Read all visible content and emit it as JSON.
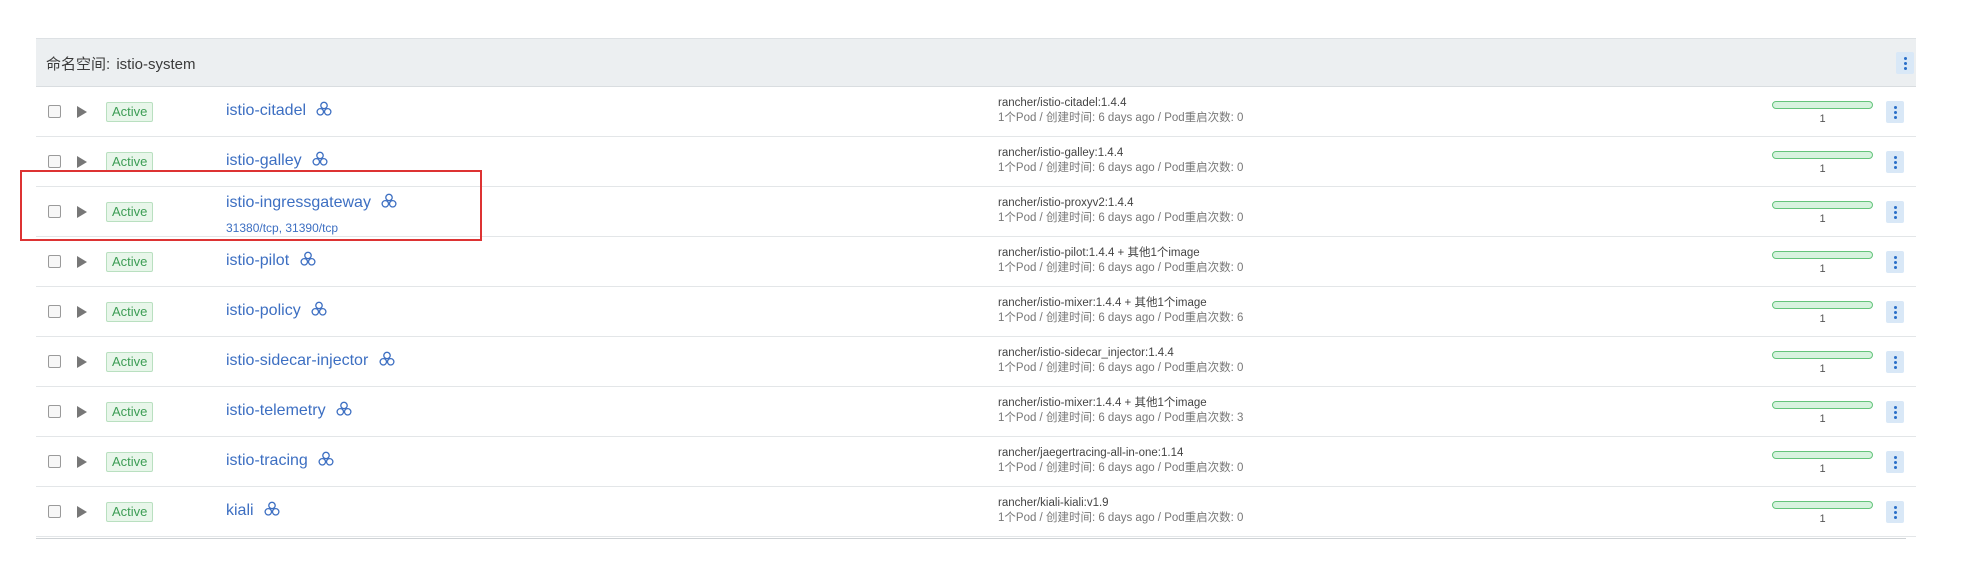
{
  "namespace": {
    "label": "命名空间:",
    "value": "istio-system"
  },
  "meta_separator": " / ",
  "rows": [
    {
      "state": "Active",
      "name": "istio-citadel",
      "ports": "",
      "image": "rancher/istio-citadel:1.4.4",
      "extra": "",
      "pods": "1个Pod",
      "created": "创建时间: 6 days ago",
      "restarts": "Pod重启次数: 0",
      "scale": "1"
    },
    {
      "state": "Active",
      "name": "istio-galley",
      "ports": "",
      "image": "rancher/istio-galley:1.4.4",
      "extra": "",
      "pods": "1个Pod",
      "created": "创建时间: 6 days ago",
      "restarts": "Pod重启次数: 0",
      "scale": "1"
    },
    {
      "state": "Active",
      "name": "istio-ingressgateway",
      "ports": "31380/tcp, 31390/tcp",
      "image": "rancher/istio-proxyv2:1.4.4",
      "extra": "",
      "pods": "1个Pod",
      "created": "创建时间: 6 days ago",
      "restarts": "Pod重启次数: 0",
      "scale": "1"
    },
    {
      "state": "Active",
      "name": "istio-pilot",
      "ports": "",
      "image": "rancher/istio-pilot:1.4.4",
      "extra": " + 其他1个image",
      "pods": "1个Pod",
      "created": "创建时间: 6 days ago",
      "restarts": "Pod重启次数: 0",
      "scale": "1"
    },
    {
      "state": "Active",
      "name": "istio-policy",
      "ports": "",
      "image": "rancher/istio-mixer:1.4.4",
      "extra": " + 其他1个image",
      "pods": "1个Pod",
      "created": "创建时间: 6 days ago",
      "restarts": "Pod重启次数: 6",
      "scale": "1"
    },
    {
      "state": "Active",
      "name": "istio-sidecar-injector",
      "ports": "",
      "image": "rancher/istio-sidecar_injector:1.4.4",
      "extra": "",
      "pods": "1个Pod",
      "created": "创建时间: 6 days ago",
      "restarts": "Pod重启次数: 0",
      "scale": "1"
    },
    {
      "state": "Active",
      "name": "istio-telemetry",
      "ports": "",
      "image": "rancher/istio-mixer:1.4.4",
      "extra": " + 其他1个image",
      "pods": "1个Pod",
      "created": "创建时间: 6 days ago",
      "restarts": "Pod重启次数: 3",
      "scale": "1"
    },
    {
      "state": "Active",
      "name": "istio-tracing",
      "ports": "",
      "image": "rancher/jaegertracing-all-in-one:1.14",
      "extra": "",
      "pods": "1个Pod",
      "created": "创建时间: 6 days ago",
      "restarts": "Pod重启次数: 0",
      "scale": "1"
    },
    {
      "state": "Active",
      "name": "kiali",
      "ports": "",
      "image": "rancher/kiali-kiali:v1.9",
      "extra": "",
      "pods": "1个Pod",
      "created": "创建时间: 6 days ago",
      "restarts": "Pod重启次数: 0",
      "scale": "1"
    }
  ],
  "icons": {
    "workload": "workload-cluster-icon",
    "expand": "expand-arrow-icon",
    "menu": "kebab-menu-icon"
  },
  "colors": {
    "active_text": "#3c9d54",
    "active_bg": "#e8f6ea",
    "link": "#3d6fc2",
    "highlight": "#dd3333"
  }
}
